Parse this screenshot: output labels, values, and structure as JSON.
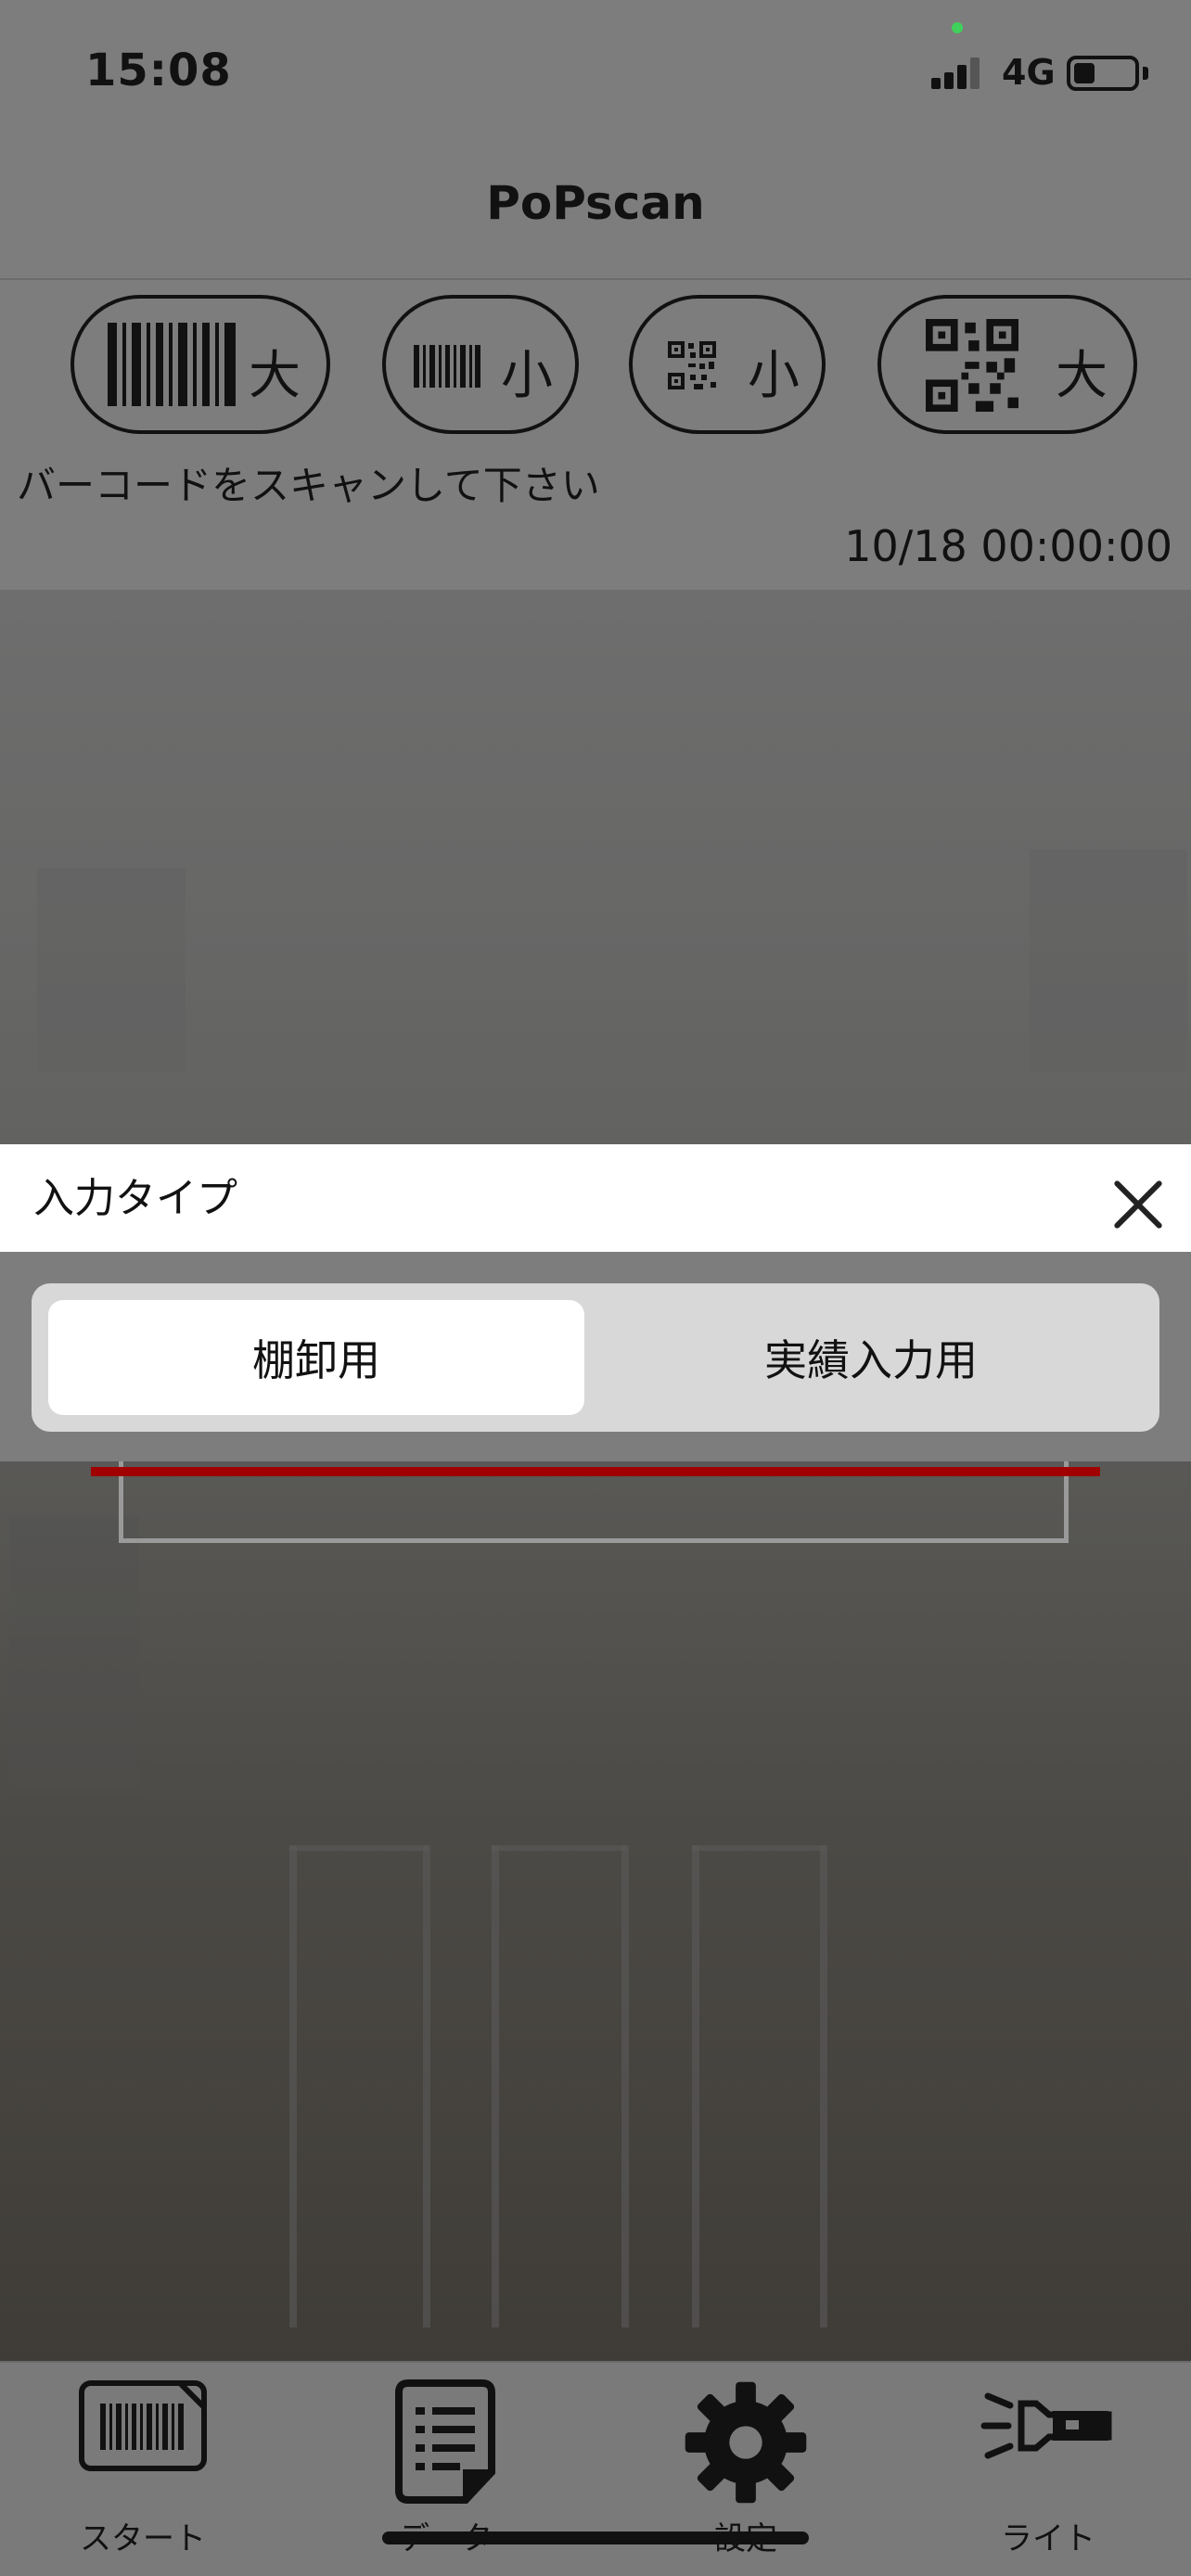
{
  "status_bar": {
    "time": "15:08",
    "network": "4G"
  },
  "nav": {
    "title": "PoPscan"
  },
  "scan_modes": [
    {
      "id": "barcode-large",
      "label": "大"
    },
    {
      "id": "barcode-small",
      "label": "小"
    },
    {
      "id": "qr-small",
      "label": "小"
    },
    {
      "id": "qr-large",
      "label": "大"
    }
  ],
  "instruction": "バーコードをスキャンして下さい",
  "datetime": "10/18 00:00:00",
  "input_type_sheet": {
    "title": "入力タイプ",
    "options": [
      "棚卸用",
      "実績入力用"
    ],
    "selected_index": 0
  },
  "tabbar": {
    "items": [
      {
        "label": "スタート",
        "icon": "barcode-icon"
      },
      {
        "label": "データ",
        "icon": "document-list-icon"
      },
      {
        "label": "設定",
        "icon": "gear-icon"
      },
      {
        "label": "ライト",
        "icon": "flashlight-icon"
      }
    ]
  },
  "colors": {
    "scan_line": "#a00000",
    "overlay": "#7d7d7d",
    "sheet": "#ffffff"
  }
}
